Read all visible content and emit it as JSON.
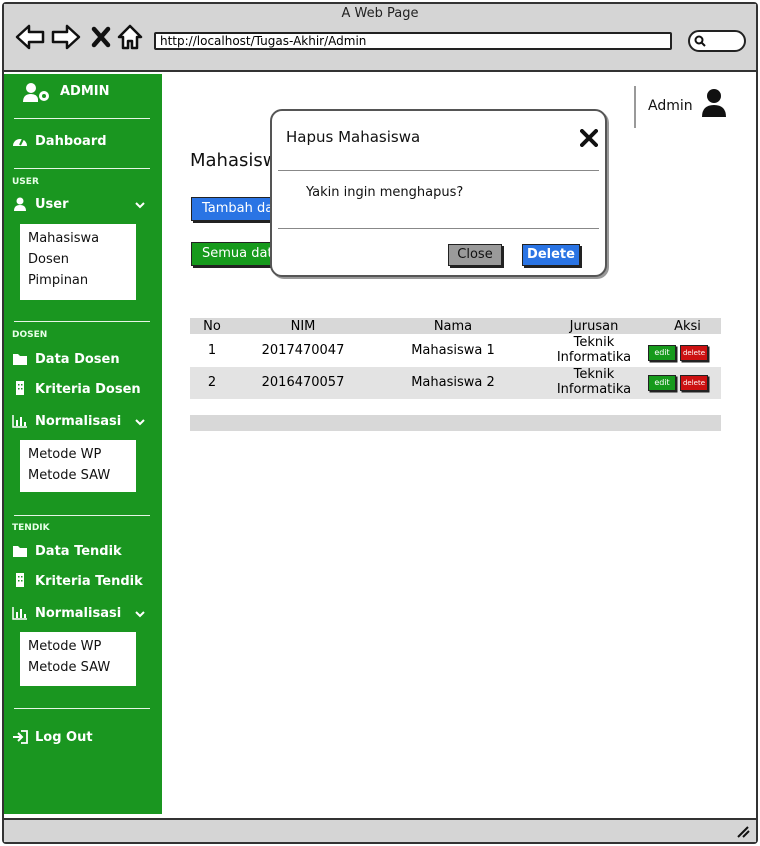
{
  "browser": {
    "window_title": "A Web Page",
    "url": "http://localhost/Tugas-Akhir/Admin"
  },
  "sidebar": {
    "brand": "ADMIN",
    "dashboard": "Dahboard",
    "sections": [
      {
        "label": "USER",
        "items": [
          {
            "label": "User",
            "icon": "user-icon",
            "expandable": true,
            "submenu": [
              "Mahasiswa",
              "Dosen",
              "Pimpinan"
            ]
          }
        ]
      },
      {
        "label": "DOSEN",
        "items": [
          {
            "label": "Data Dosen",
            "icon": "folder-icon"
          },
          {
            "label": "Kriteria Dosen",
            "icon": "building-icon"
          },
          {
            "label": "Normalisasi",
            "icon": "bar-chart-icon",
            "expandable": true,
            "submenu": [
              "Metode WP",
              "Metode SAW"
            ]
          }
        ]
      },
      {
        "label": "TENDIK",
        "items": [
          {
            "label": "Data Tendik",
            "icon": "folder-icon"
          },
          {
            "label": "Kriteria Tendik",
            "icon": "building-icon"
          },
          {
            "label": "Normalisasi",
            "icon": "bar-chart-icon",
            "expandable": true,
            "submenu": [
              "Metode WP",
              "Metode SAW"
            ]
          }
        ]
      }
    ],
    "logout": "Log Out"
  },
  "header": {
    "user_name": "Admin"
  },
  "main": {
    "title": "Mahasiswa",
    "add_button": "Tambah data",
    "all_button": "Semua data",
    "table": {
      "columns": [
        "No",
        "NIM",
        "Nama",
        "Jurusan",
        "Aksi"
      ],
      "rows": [
        {
          "no": "1",
          "nim": "2017470047",
          "nama": "Mahasiswa 1",
          "jurusan_line1": "Teknik",
          "jurusan_line2": "Informatika",
          "edit": "edit",
          "delete": "delete"
        },
        {
          "no": "2",
          "nim": "2016470057",
          "nama": "Mahasiswa 2",
          "jurusan_line1": "Teknik",
          "jurusan_line2": "Informatika",
          "edit": "edit",
          "delete": "delete"
        }
      ]
    }
  },
  "modal": {
    "title": "Hapus Mahasiswa",
    "message": "Yakin ingin menghapus?",
    "close_label": "Close",
    "delete_label": "Delete"
  },
  "colors": {
    "sidebar": "#1a9620",
    "primary": "#2a74e4",
    "success": "#169a1c",
    "danger": "#cc1111",
    "chrome": "#d5d5d5"
  }
}
